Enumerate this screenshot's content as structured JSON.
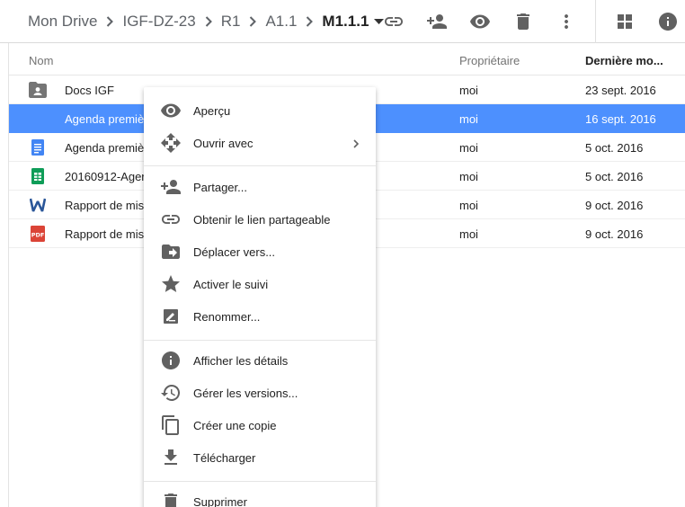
{
  "breadcrumb": {
    "items": [
      "Mon Drive",
      "IGF-DZ-23",
      "R1",
      "A1.1"
    ],
    "current": "M1.1.1"
  },
  "toolbar": {
    "icons": [
      "link-icon",
      "share-person-icon",
      "preview-eye-icon",
      "trash-icon",
      "more-vert-icon",
      "grid-view-icon",
      "info-icon"
    ]
  },
  "list": {
    "headers": {
      "name": "Nom",
      "owner": "Propriétaire",
      "modified": "Dernière mo..."
    },
    "rows": [
      {
        "icon": "shared-folder-icon",
        "name": "Docs IGF",
        "owner": "moi",
        "date": "23 sept. 2016"
      },
      {
        "icon": "doc-icon",
        "name": "Agenda premiè",
        "owner": "moi",
        "date": "16 sept. 2016",
        "selected": true
      },
      {
        "icon": "doc-icon",
        "name": "Agenda premiè",
        "owner": "moi",
        "date": "5 oct. 2016"
      },
      {
        "icon": "sheet-icon",
        "name": "20160912-Ager",
        "owner": "moi",
        "date": "5 oct. 2016"
      },
      {
        "icon": "word-icon",
        "name": "Rapport de mis",
        "owner": "moi",
        "date": "9 oct. 2016"
      },
      {
        "icon": "pdf-icon",
        "name": "Rapport de mis",
        "owner": "moi",
        "date": "9 oct. 2016"
      }
    ]
  },
  "menu": {
    "items": [
      {
        "label": "Aperçu",
        "icon": "eye-icon"
      },
      {
        "label": "Ouvrir avec",
        "icon": "open-with-icon"
      },
      {
        "label": "Partager...",
        "icon": "add-person-icon"
      },
      {
        "label": "Obtenir le lien partageable",
        "icon": "link-icon"
      },
      {
        "label": "Déplacer vers...",
        "icon": "move-folder-icon"
      },
      {
        "label": "Activer le suivi",
        "icon": "star-icon"
      },
      {
        "label": "Renommer...",
        "icon": "rename-icon"
      },
      {
        "label": "Afficher les détails",
        "icon": "info-icon"
      },
      {
        "label": "Gérer les versions...",
        "icon": "history-icon"
      },
      {
        "label": "Créer une copie",
        "icon": "copy-icon"
      },
      {
        "label": "Télécharger",
        "icon": "download-icon"
      },
      {
        "label": "Supprimer",
        "icon": "trash-icon"
      }
    ]
  },
  "colors": {
    "selection": "#4d90fe",
    "icon_gray": "#616161",
    "doc_blue": "#4285f4",
    "sheet_green": "#0f9d58",
    "pdf_red": "#db4437",
    "word_blue": "#2a5699"
  }
}
